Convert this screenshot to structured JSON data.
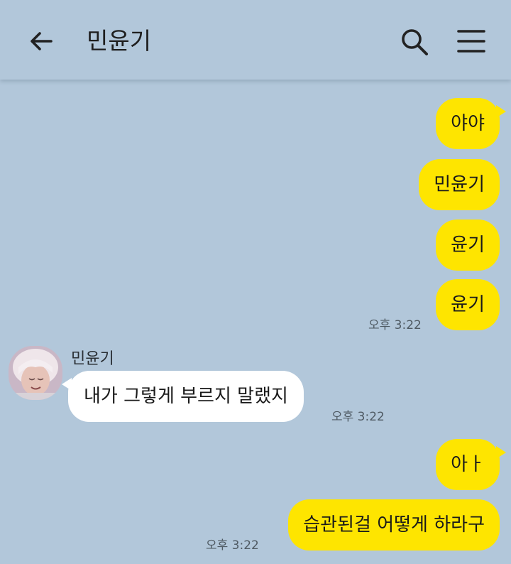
{
  "header": {
    "title": "민윤기",
    "back_icon": "arrow-left-icon",
    "search_icon": "search-icon",
    "menu_icon": "hamburger-menu-icon"
  },
  "messages": [
    {
      "sender": "me",
      "text": "야야"
    },
    {
      "sender": "me",
      "text": "민윤기"
    },
    {
      "sender": "me",
      "text": "윤기"
    },
    {
      "sender": "me",
      "text": "윤기",
      "time": "오후 3:22"
    },
    {
      "sender": "other",
      "name": "민윤기",
      "text": "내가 그렇게 부르지 말랬지",
      "time": "오후 3:22"
    },
    {
      "sender": "me",
      "text": "아ㅏ"
    },
    {
      "sender": "me",
      "text": "습관된걸 어떻게 하라구",
      "time": "오후 3:22"
    }
  ],
  "colors": {
    "background": "#b2c7da",
    "my_bubble": "#fee500",
    "their_bubble": "#ffffff"
  }
}
